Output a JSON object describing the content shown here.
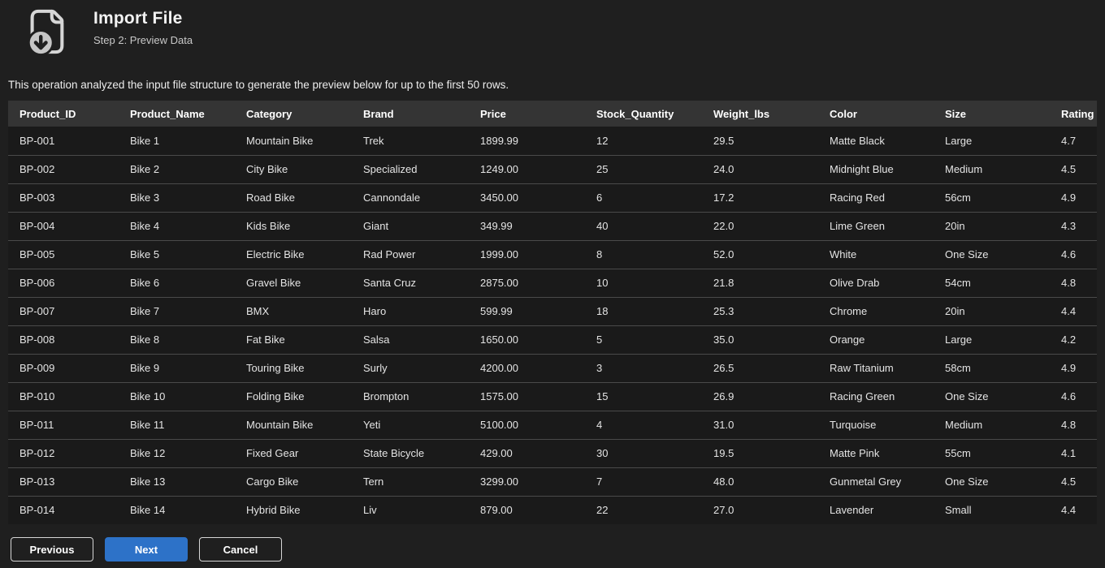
{
  "page": {
    "title": "Import File",
    "subtitle": "Step 2: Preview Data",
    "description": "This operation analyzed the input file structure to generate the preview below for up to the first 50 rows.",
    "icon": "file-download-icon"
  },
  "colors": {
    "background": "#1f1f1f",
    "table_header_bg": "#343434",
    "table_row_bg": "#1a1a1a",
    "row_separator": "#4a4a4a",
    "primary_button": "#2d72c8",
    "text": "#e6e6e6"
  },
  "table": {
    "columns": [
      "Product_ID",
      "Product_Name",
      "Category",
      "Brand",
      "Price",
      "Stock_Quantity",
      "Weight_lbs",
      "Color",
      "Size",
      "Rating"
    ],
    "rows": [
      [
        "BP-001",
        "Bike 1",
        "Mountain Bike",
        "Trek",
        "1899.99",
        "12",
        "29.5",
        "Matte Black",
        "Large",
        "4.7"
      ],
      [
        "BP-002",
        "Bike 2",
        "City Bike",
        "Specialized",
        "1249.00",
        "25",
        "24.0",
        "Midnight Blue",
        "Medium",
        "4.5"
      ],
      [
        "BP-003",
        "Bike 3",
        "Road Bike",
        "Cannondale",
        "3450.00",
        "6",
        "17.2",
        "Racing Red",
        "56cm",
        "4.9"
      ],
      [
        "BP-004",
        "Bike 4",
        "Kids Bike",
        "Giant",
        "349.99",
        "40",
        "22.0",
        "Lime Green",
        "20in",
        "4.3"
      ],
      [
        "BP-005",
        "Bike 5",
        "Electric Bike",
        "Rad Power",
        "1999.00",
        "8",
        "52.0",
        "White",
        "One Size",
        "4.6"
      ],
      [
        "BP-006",
        "Bike 6",
        "Gravel Bike",
        "Santa Cruz",
        "2875.00",
        "10",
        "21.8",
        "Olive Drab",
        "54cm",
        "4.8"
      ],
      [
        "BP-007",
        "Bike 7",
        "BMX",
        "Haro",
        "599.99",
        "18",
        "25.3",
        "Chrome",
        "20in",
        "4.4"
      ],
      [
        "BP-008",
        "Bike 8",
        "Fat Bike",
        "Salsa",
        "1650.00",
        "5",
        "35.0",
        "Orange",
        "Large",
        "4.2"
      ],
      [
        "BP-009",
        "Bike 9",
        "Touring Bike",
        "Surly",
        "4200.00",
        "3",
        "26.5",
        "Raw Titanium",
        "58cm",
        "4.9"
      ],
      [
        "BP-010",
        "Bike 10",
        "Folding Bike",
        "Brompton",
        "1575.00",
        "15",
        "26.9",
        "Racing Green",
        "One Size",
        "4.6"
      ],
      [
        "BP-011",
        "Bike 11",
        "Mountain Bike",
        "Yeti",
        "5100.00",
        "4",
        "31.0",
        "Turquoise",
        "Medium",
        "4.8"
      ],
      [
        "BP-012",
        "Bike 12",
        "Fixed Gear",
        "State Bicycle",
        "429.00",
        "30",
        "19.5",
        "Matte Pink",
        "55cm",
        "4.1"
      ],
      [
        "BP-013",
        "Bike 13",
        "Cargo Bike",
        "Tern",
        "3299.00",
        "7",
        "48.0",
        "Gunmetal Grey",
        "One Size",
        "4.5"
      ],
      [
        "BP-014",
        "Bike 14",
        "Hybrid Bike",
        "Liv",
        "879.00",
        "22",
        "27.0",
        "Lavender",
        "Small",
        "4.4"
      ]
    ]
  },
  "footer": {
    "previous_label": "Previous",
    "next_label": "Next",
    "cancel_label": "Cancel"
  }
}
